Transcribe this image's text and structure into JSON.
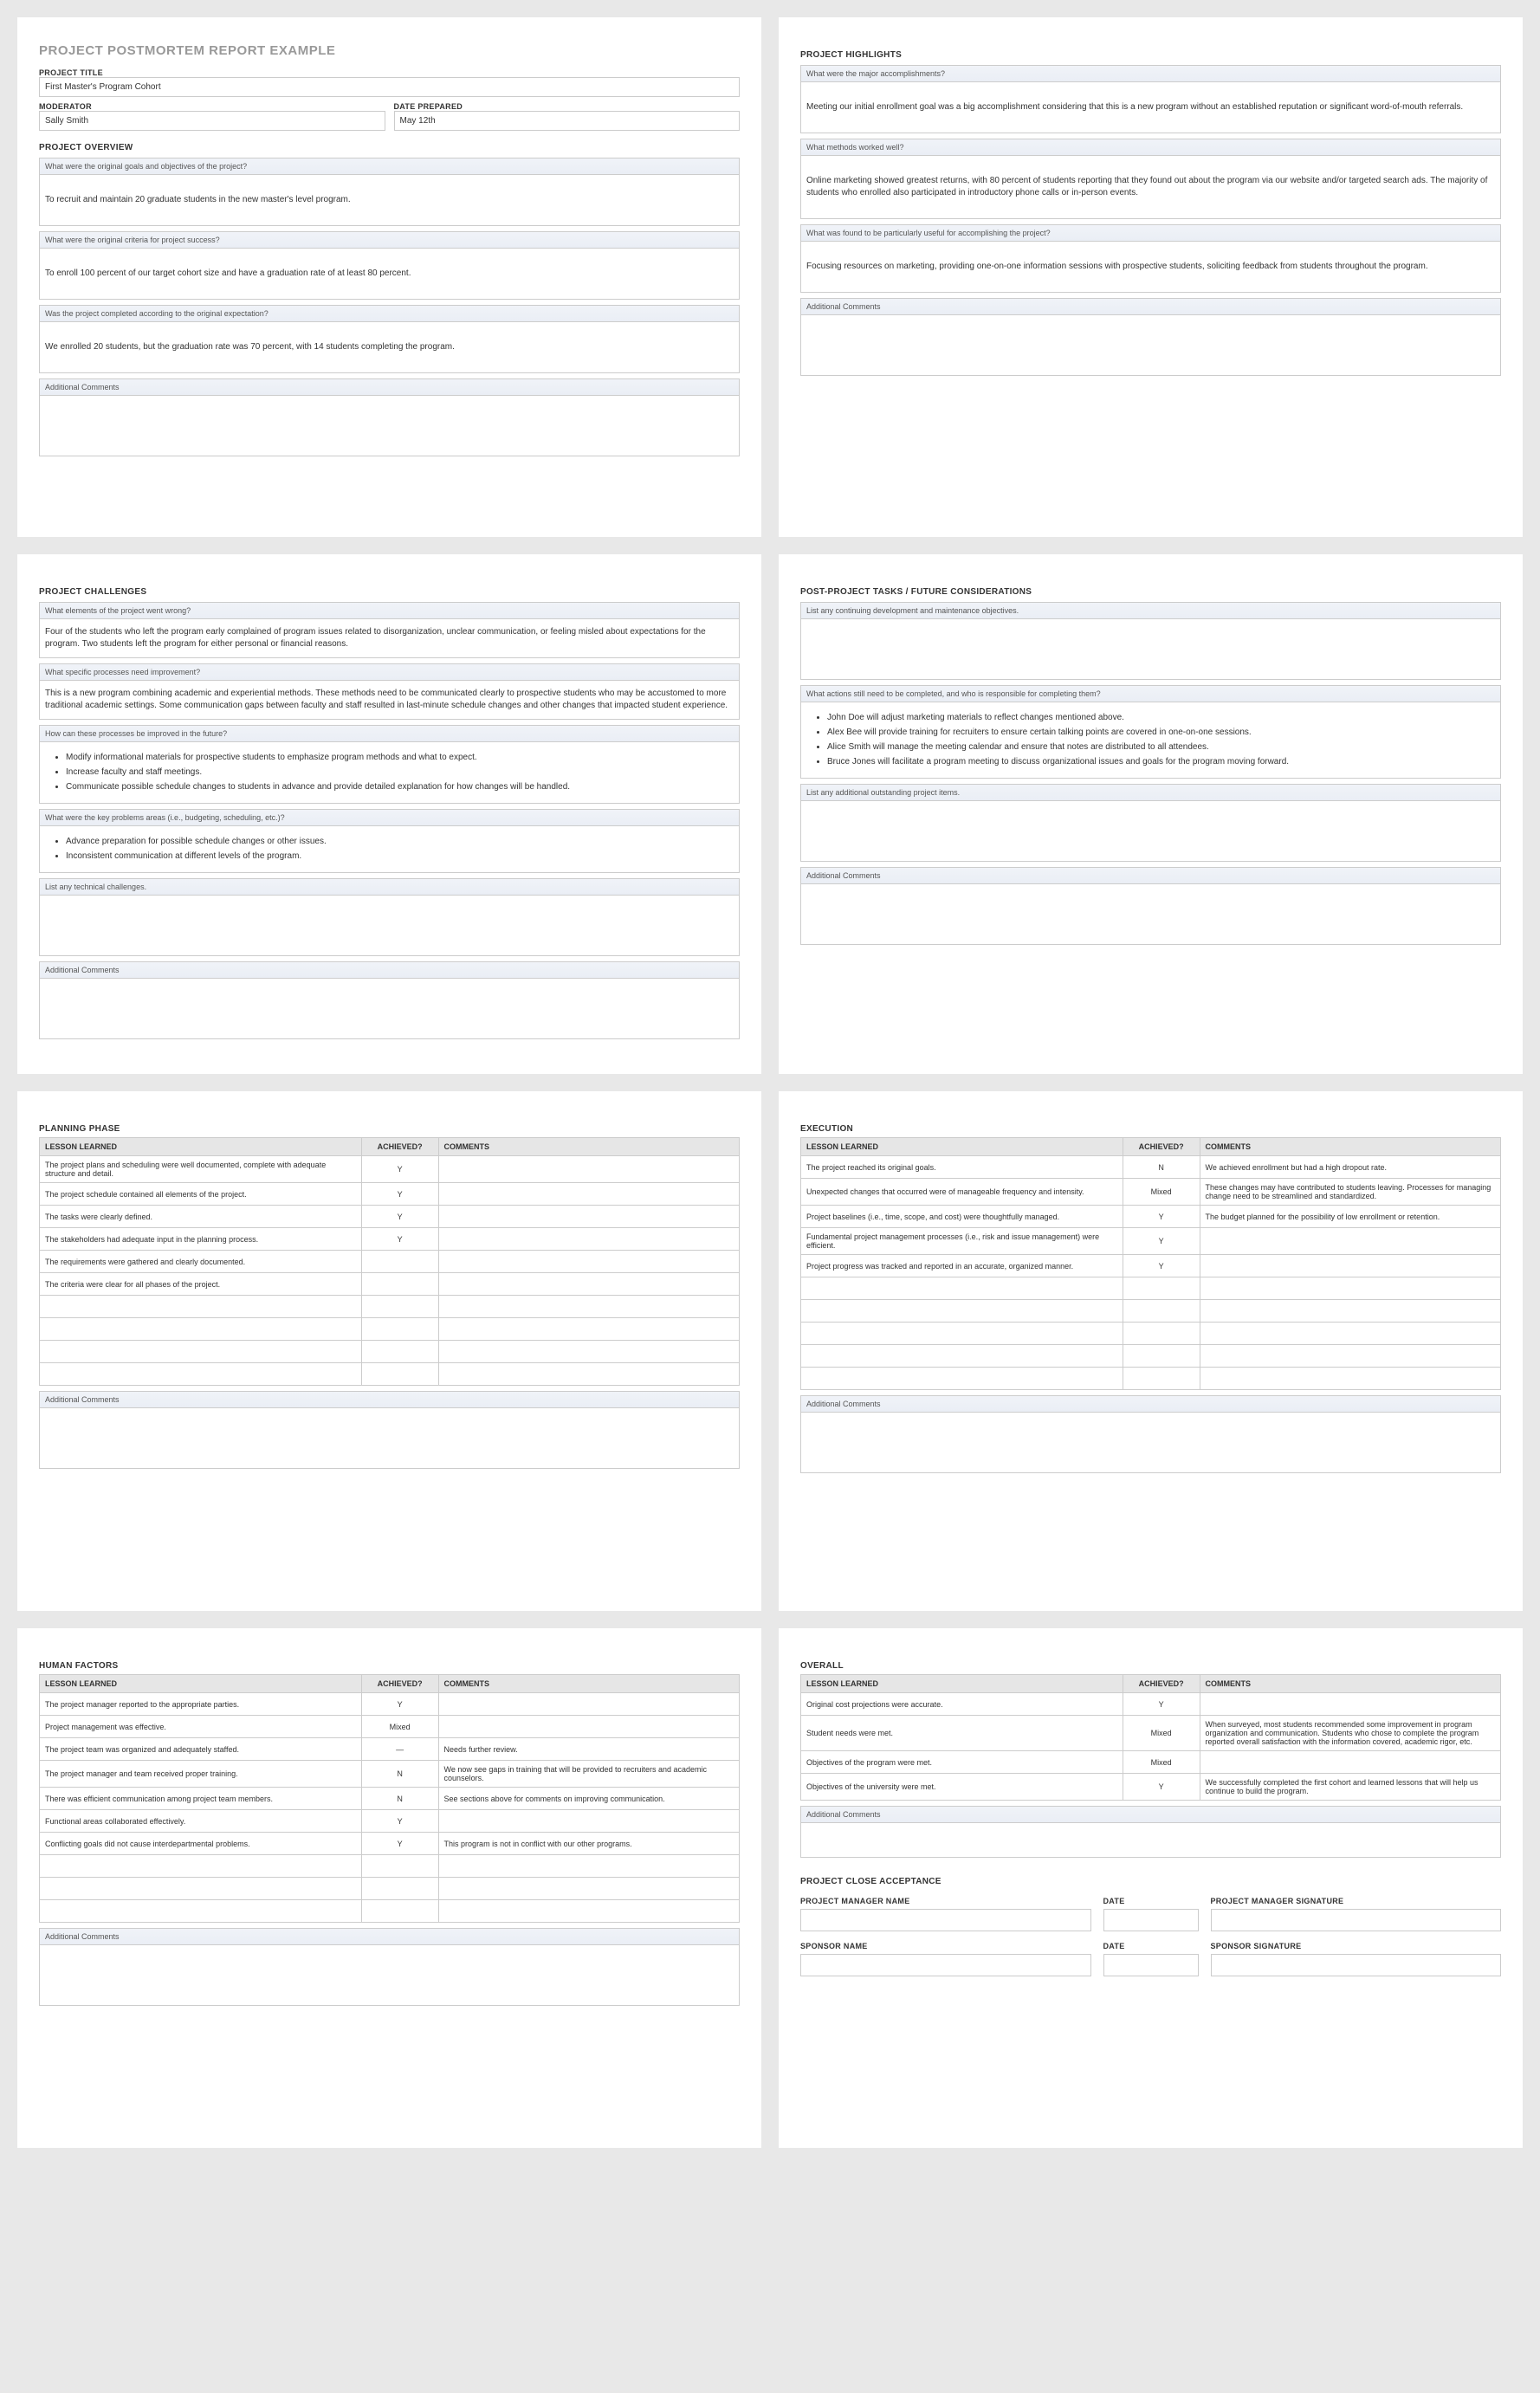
{
  "main_title": "PROJECT POSTMORTEM REPORT EXAMPLE",
  "meta": {
    "title_lbl": "PROJECT TITLE",
    "title_val": "First Master's Program Cohort",
    "mod_lbl": "MODERATOR",
    "mod_val": "Sally Smith",
    "date_lbl": "DATE PREPARED",
    "date_val": "May 12th"
  },
  "overview": {
    "heading": "PROJECT OVERVIEW",
    "q1": "What were the original goals and objectives of the project?",
    "a1": "To recruit and maintain 20 graduate students in the new master's level program.",
    "q2": "What were the original criteria for project success?",
    "a2": "To enroll 100 percent of our target cohort size and have a graduation rate of at least 80 percent.",
    "q3": "Was the project completed according to the original expectation?",
    "a3": "We enrolled 20 students, but the graduation rate was 70 percent, with 14 students completing the program.",
    "addl": "Additional Comments"
  },
  "highlights": {
    "heading": "PROJECT HIGHLIGHTS",
    "q1": "What were the major accomplishments?",
    "a1": "Meeting our initial enrollment goal was a big accomplishment considering that this is a new program without an established reputation or significant word-of-mouth referrals.",
    "q2": "What methods worked well?",
    "a2": "Online marketing showed greatest returns, with 80 percent of students reporting that they found out about the program via our website and/or targeted search ads. The majority of students who enrolled also participated in introductory phone calls or in-person events.",
    "q3": "What was found to be particularly useful for accomplishing the project?",
    "a3": "Focusing resources on marketing, providing one-on-one information sessions with prospective students, soliciting feedback from students throughout the program.",
    "addl": "Additional Comments"
  },
  "challenges": {
    "heading": "PROJECT CHALLENGES",
    "q1": "What elements of the project went wrong?",
    "a1": "Four of the students who left the program early complained of program issues related to disorganization, unclear communication, or feeling misled  about expectations for the program. Two students left the program for either personal or financial reasons.",
    "q2": "What specific processes need improvement?",
    "a2": "This is a new program combining academic and experiential methods. These methods need to be communicated clearly to prospective students who may be accustomed to more traditional academic settings. Some communication gaps between faculty and staff resulted in last-minute schedule changes and other changes that impacted student experience.",
    "q3": "How can these processes be improved in the future?",
    "l3a": "Modify informational materials for prospective students to emphasize program methods and what to expect.",
    "l3b": "Increase faculty and staff meetings.",
    "l3c": "Communicate possible schedule changes to students in advance and provide detailed explanation for how changes will be handled.",
    "q4": "What were the key problems areas (i.e., budgeting, scheduling, etc.)?",
    "l4a": "Advance preparation for possible schedule changes or other issues.",
    "l4b": "Inconsistent communication at different levels of the program.",
    "q5": "List any technical challenges.",
    "addl": "Additional Comments"
  },
  "postproj": {
    "heading": "POST-PROJECT TASKS / FUTURE CONSIDERATIONS",
    "q1": "List any continuing development and maintenance objectives.",
    "q2": "What actions still need to be completed, and who is responsible for completing them?",
    "l2a": "John Doe will adjust marketing materials to reflect changes mentioned above.",
    "l2b": "Alex Bee will provide training for recruiters to ensure certain talking points are covered in one-on-one sessions.",
    "l2c": "Alice Smith will manage the meeting calendar and ensure that notes are distributed to all attendees.",
    "l2d": "Bruce Jones will facilitate a program meeting to discuss organizational issues and goals for the program moving forward.",
    "q3": "List any additional outstanding project items.",
    "addl": "Additional Comments"
  },
  "th": {
    "lesson": "LESSON LEARNED",
    "ach": "ACHIEVED?",
    "com": "COMMENTS"
  },
  "planning": {
    "heading": "PLANNING PHASE",
    "r1l": "The project plans and scheduling were well documented, complete with adequate structure and detail.",
    "r1a": "Y",
    "r2l": "The project schedule contained all elements of the project.",
    "r2a": "Y",
    "r3l": "The tasks were clearly defined.",
    "r3a": "Y",
    "r4l": "The stakeholders had adequate input in the planning process.",
    "r4a": "Y",
    "r5l": "The requirements were gathered and clearly documented.",
    "r6l": "The criteria were clear for all phases of the project.",
    "addl": "Additional Comments"
  },
  "execution": {
    "heading": "EXECUTION",
    "r1l": "The project reached its original goals.",
    "r1a": "N",
    "r1c": "We achieved enrollment but had a high dropout rate.",
    "r2l": "Unexpected changes that occurred were of manageable frequency and intensity.",
    "r2a": "Mixed",
    "r2c": "These changes may have contributed to students leaving. Processes for managing change need to be streamlined and standardized.",
    "r3l": "Project baselines (i.e., time, scope, and cost) were thoughtfully managed.",
    "r3a": "Y",
    "r3c": "The budget planned for the possibility of low enrollment or retention.",
    "r4l": "Fundamental project management processes (i.e., risk and issue management) were efficient.",
    "r4a": "Y",
    "r5l": "Project progress was tracked and reported in an accurate, organized manner.",
    "r5a": "Y",
    "addl": "Additional Comments"
  },
  "human": {
    "heading": "HUMAN FACTORS",
    "r1l": "The project manager reported to the appropriate parties.",
    "r1a": "Y",
    "r2l": "Project management was effective.",
    "r2a": "Mixed",
    "r3l": "The project team was organized and adequately staffed.",
    "r3a": "—",
    "r3c": "Needs further review.",
    "r4l": "The project manager and team received proper training.",
    "r4a": "N",
    "r4c": "We now see gaps in training that will be provided to recruiters and academic counselors.",
    "r5l": "There was efficient communication among project team members.",
    "r5a": "N",
    "r5c": "See sections above for comments on improving communication.",
    "r6l": "Functional areas collaborated effectively.",
    "r6a": "Y",
    "r7l": "Conflicting goals did not cause interdepartmental problems.",
    "r7a": "Y",
    "r7c": "This program is not in conflict with our other programs.",
    "addl": "Additional Comments"
  },
  "overall": {
    "heading": "OVERALL",
    "r1l": "Original cost projections were accurate.",
    "r1a": "Y",
    "r2l": "Student needs were met.",
    "r2a": "Mixed",
    "r2c": "When surveyed, most students recommended some improvement in program organization and communication. Students who chose to complete the program reported overall satisfaction with the information covered, academic rigor, etc.",
    "r3l": "Objectives of the program were met.",
    "r3a": "Mixed",
    "r4l": "Objectives of the university were met.",
    "r4a": "Y",
    "r4c": "We successfully completed the first cohort and learned lessons that will help us continue to build the program.",
    "addl": "Additional Comments"
  },
  "close": {
    "heading": "PROJECT CLOSE ACCEPTANCE",
    "pm": "PROJECT MANAGER NAME",
    "date": "DATE",
    "pmsig": "PROJECT MANAGER SIGNATURE",
    "sp": "SPONSOR NAME",
    "spsig": "SPONSOR SIGNATURE"
  }
}
